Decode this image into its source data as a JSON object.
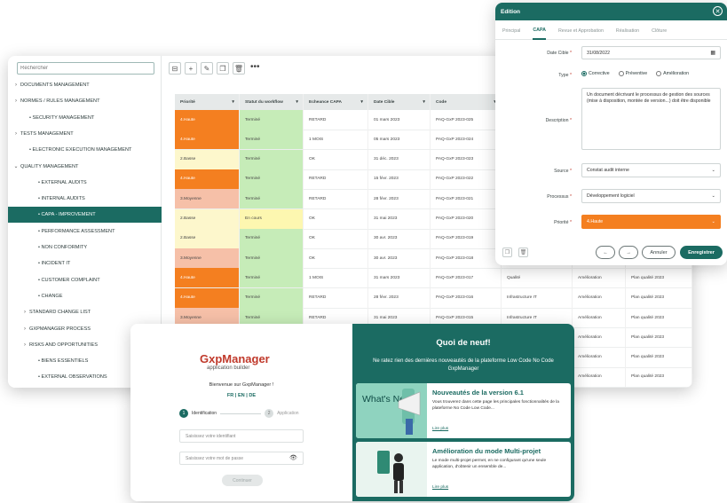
{
  "sidebar": {
    "search_placeholder": "Rechercher",
    "items": [
      {
        "label": "DOCUMENTS MANAGEMENT",
        "chevron": "›"
      },
      {
        "label": "NORMES / RULES MANAGEMENT",
        "chevron": "›"
      },
      {
        "label": "• SECURITY MANAGEMENT",
        "chevron": ""
      },
      {
        "label": "TESTS MANAGEMENT",
        "chevron": "›"
      },
      {
        "label": "• ELECTRONIC EXECUTION MANAGEMENT",
        "chevron": ""
      },
      {
        "label": "QUALITY MANAGEMENT",
        "chevron": "⌄"
      },
      {
        "label": "• EXTERNAL AUDITS",
        "chevron": ""
      },
      {
        "label": "• INTERNAL AUDITS",
        "chevron": ""
      },
      {
        "label": "• CAPA - IMPROVEMENT",
        "chevron": ""
      },
      {
        "label": "• PERFORMANCE ASSESSMENT",
        "chevron": ""
      },
      {
        "label": "• NON CONFORMITY",
        "chevron": ""
      },
      {
        "label": "• INCIDENT IT",
        "chevron": ""
      },
      {
        "label": "• CUSTOMER COMPLAINT",
        "chevron": ""
      },
      {
        "label": "• CHANGE",
        "chevron": ""
      },
      {
        "label": "STANDARD CHANGE LIST",
        "chevron": "›"
      },
      {
        "label": "GXPMANAGER PROCESS",
        "chevron": "›"
      },
      {
        "label": "RISKS AND OPPORTUNITIES",
        "chevron": "›"
      },
      {
        "label": "• BIENS ESSENTIELS",
        "chevron": ""
      },
      {
        "label": "• EXTERNAL OBSERVATIONS",
        "chevron": ""
      }
    ]
  },
  "toolbar": {
    "more": "•••",
    "icons": [
      "⊟",
      "+",
      "✎",
      "❐",
      "🗑"
    ]
  },
  "grid": {
    "columns": [
      "Priorité",
      "Statut du workflow",
      "Echeance CAPA",
      "Date Cible",
      "Code",
      "",
      "",
      ""
    ],
    "rows": [
      {
        "priorite": "4.Haute",
        "statut": "Terminé",
        "echeance": "RETARD",
        "date": "01 mars 2023",
        "code": "PAQ-GxP 2023-025",
        "c6": "",
        "c7": "",
        "c8": ""
      },
      {
        "priorite": "4.Haute",
        "statut": "Terminé",
        "echeance": "1 MOIS",
        "date": "05 mars 2023",
        "code": "PAQ-GxP 2023-024",
        "c6": "",
        "c7": "",
        "c8": ""
      },
      {
        "priorite": "2.Basse",
        "statut": "Terminé",
        "echeance": "OK",
        "date": "31 déc. 2023",
        "code": "PAQ-GxP 2023-023",
        "c6": "",
        "c7": "",
        "c8": ""
      },
      {
        "priorite": "4.Haute",
        "statut": "Terminé",
        "echeance": "RETARD",
        "date": "15 févr. 2023",
        "code": "PAQ-GxP 2023-022",
        "c6": "",
        "c7": "",
        "c8": ""
      },
      {
        "priorite": "3.Moyenne",
        "statut": "Terminé",
        "echeance": "RETARD",
        "date": "28 févr. 2023",
        "code": "PAQ-GxP 2023-021",
        "c6": "",
        "c7": "",
        "c8": ""
      },
      {
        "priorite": "2.Basse",
        "statut": "En cours",
        "echeance": "OK",
        "date": "31 mai 2023",
        "code": "PAQ-GxP 2023-020",
        "c6": "",
        "c7": "",
        "c8": ""
      },
      {
        "priorite": "2.Basse",
        "statut": "Terminé",
        "echeance": "OK",
        "date": "30 avr. 2023",
        "code": "PAQ-GxP 2023-019",
        "c6": "",
        "c7": "",
        "c8": ""
      },
      {
        "priorite": "3.Moyenne",
        "statut": "Terminé",
        "echeance": "OK",
        "date": "30 avr. 2023",
        "code": "PAQ-GxP 2023-018",
        "c6": "",
        "c7": "",
        "c8": ""
      },
      {
        "priorite": "4.Haute",
        "statut": "Terminé",
        "echeance": "1 MOIS",
        "date": "31 mars 2023",
        "code": "PAQ-GxP 2023-017",
        "c6": "Qualité",
        "c7": "Amélioration",
        "c8": "Plan qualité 2023"
      },
      {
        "priorite": "4.Haute",
        "statut": "Terminé",
        "echeance": "RETARD",
        "date": "28 févr. 2023",
        "code": "PAQ-GxP 2023-016",
        "c6": "Infrastructure IT",
        "c7": "Amélioration",
        "c8": "Plan qualité 2023"
      },
      {
        "priorite": "3.Moyenne",
        "statut": "Terminé",
        "echeance": "RETARD",
        "date": "31 mai 2023",
        "code": "PAQ-GxP 2023-015",
        "c6": "Infrastructure IT",
        "c7": "Amélioration",
        "c8": "Plan qualité 2023"
      },
      {
        "priorite": "",
        "statut": "",
        "echeance": "",
        "date": "",
        "code": "",
        "c6": "",
        "c7": "Amélioration",
        "c8": "Plan qualité 2023"
      },
      {
        "priorite": "",
        "statut": "",
        "echeance": "",
        "date": "",
        "code": "",
        "c6": "",
        "c7": "Amélioration",
        "c8": "Plan qualité 2023"
      },
      {
        "priorite": "",
        "statut": "",
        "echeance": "",
        "date": "",
        "code": "",
        "c6": "",
        "c7": "Amélioration",
        "c8": "Plan qualité 2023"
      }
    ]
  },
  "colors": {
    "brand": "#1b6b62",
    "haute": "#f47f20",
    "moyenne": "#f6c0a8",
    "basse": "#fdf7cc",
    "termine": "#c6ecb8",
    "en_cours": "#fdf7b0"
  },
  "edition": {
    "title": "Edition",
    "tabs": [
      "Principal",
      "CAPA",
      "Revue et Approbation",
      "Réalisation",
      "Clôture"
    ],
    "date_label": "Date Cible",
    "date_value": "31/08/2022",
    "type_label": "Type",
    "type_options": [
      "Corrective",
      "Préventive",
      "Amélioration"
    ],
    "description_label": "Description",
    "description_value": "Un document décrivant le processus de gestion des sources (mise à disposition, montée de version...) doit être disponible",
    "source_label": "Source",
    "source_value": "Constat audit interne",
    "processus_label": "Processus",
    "processus_value": "Développement logiciel",
    "priorite_label": "Priorité",
    "priorite_value": "4.Haute",
    "required_mark": "*",
    "cancel_label": "Annuler",
    "save_label": "Enregistrer"
  },
  "login": {
    "logo_title": "GxpManager",
    "logo_subtitle": "application builder",
    "welcome": "Bienvenue sur GxpManager !",
    "langs": "FR | EN | DE",
    "step1_num": "1",
    "step1_label": "Identification",
    "step2_num": "2",
    "step2_label": "Application",
    "id_placeholder": "Saisissez votre identifiant",
    "password_placeholder": "Saisissez votre mot de passe",
    "continue_label": "Continuer"
  },
  "news": {
    "title": "Quoi de neuf!",
    "subtitle": "Ne ratez rien des dernières nouveautés de la plateforme Low Code No Code GxpManager",
    "cards": [
      {
        "title": "Nouveautés de la version 6.1",
        "text": "Vous trouverez dans cette page les principales fonctionnalités de la plateforme No Code Low Code...",
        "link": "Lire plus",
        "image_text": "What's New!"
      },
      {
        "title": "Amélioration du mode Multi-projet",
        "text": "Le mode multi-projet permet, en ne configurant qu'une seule application, d'obtenir un ensemble de...",
        "link": "Lire plus"
      }
    ]
  }
}
